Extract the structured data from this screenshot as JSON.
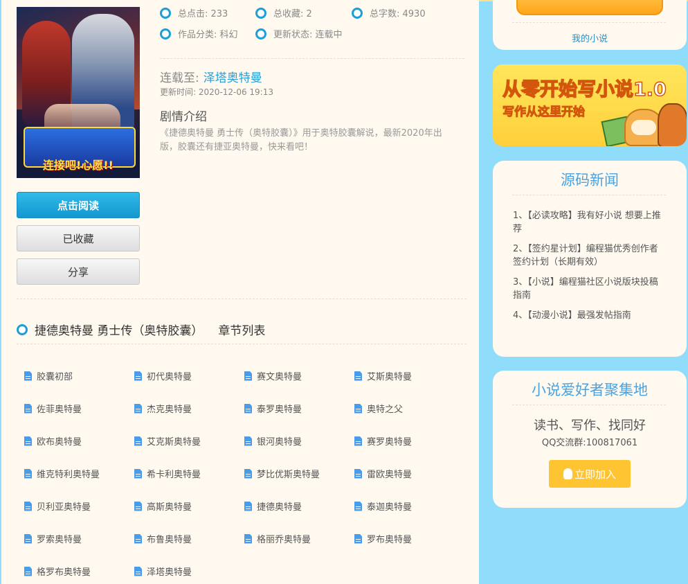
{
  "stats": {
    "clicks": "总点击: 233",
    "favorites": "总收藏: 2",
    "words": "总字数: 4930",
    "category": "作品分类: 科幻",
    "status": "更新状态: 连载中"
  },
  "update": {
    "label": "连载至:",
    "latest": "泽塔奥特曼",
    "time": "更新时间: 2020-12-06 19:13"
  },
  "intro": {
    "title": "剧情介绍",
    "text": "《捷德奥特曼 勇士传（奥特胶囊）》用于奥特胶囊解说，最新2020年出版，胶囊还有捷亚奥特曼，快来看吧！"
  },
  "cover": {
    "logo_text": "连接吧!心愿!!"
  },
  "buttons": {
    "read": "点击阅读",
    "favorited": "已收藏",
    "share": "分享"
  },
  "section": {
    "book_title": "捷德奥特曼 勇士传（奥特胶囊）",
    "chapter_list": "章节列表"
  },
  "chapters": [
    "胶囊初部",
    "初代奥特曼",
    "赛文奥特曼",
    "艾斯奥特曼",
    "佐菲奥特曼",
    "杰克奥特曼",
    "泰罗奥特曼",
    "奥特之父",
    "欧布奥特曼",
    "艾克斯奥特曼",
    "银河奥特曼",
    "赛罗奥特曼",
    "维克特利奥特曼",
    "希卡利奥特曼",
    "梦比优斯奥特曼",
    "雷欧奥特曼",
    "贝利亚奥特曼",
    "高斯奥特曼",
    "捷德奥特曼",
    "泰迦奥特曼",
    "罗索奥特曼",
    "布鲁奥特曼",
    "格丽乔奥特曼",
    "罗布奥特曼",
    "格罗布奥特曼",
    "泽塔奥特曼"
  ],
  "sidebar": {
    "my_novel": "我的小说",
    "banner_title": "从零开始写小说1.0",
    "banner_sub": "写作从这里开始",
    "news_title": "源码新闻",
    "news": [
      "1、【必读攻略】我有好小说 想要上推荐",
      "2、【签约星计划】编程猫优秀创作者签约计划（长期有效）",
      "3、【小说】编程猫社区小说版块投稿指南",
      "4、【动漫小说】最强发帖指南"
    ],
    "community_title": "小说爱好者聚集地",
    "tagline": "读书、写作、找同好",
    "qq_group": "QQ交流群:100817061",
    "join": "立即加入"
  },
  "colors": {
    "accent": "#1c9fd8",
    "page_bg": "#8fdcfb",
    "content_bg": "#fff9f0",
    "join": "#ffc431"
  }
}
